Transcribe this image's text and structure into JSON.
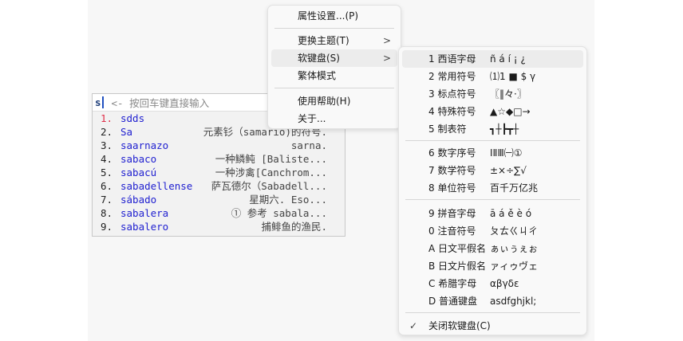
{
  "candidate": {
    "input_code": "s",
    "hint": "<- 按回车键直接输入",
    "items": [
      {
        "num": "1.",
        "word": "sdds",
        "desc": ""
      },
      {
        "num": "2.",
        "word": "Sa",
        "desc": "元素钐（samario)的符号."
      },
      {
        "num": "3.",
        "word": "saarnazo",
        "desc": "sarna."
      },
      {
        "num": "4.",
        "word": "sabaco",
        "desc": "一种鳞鲀 [Baliste..."
      },
      {
        "num": "5.",
        "word": "sabacú",
        "desc": "一种涉禽[Canchrom..."
      },
      {
        "num": "6.",
        "word": "sabadellense",
        "desc": "萨瓦德尔（Sabadell..."
      },
      {
        "num": "7.",
        "word": "sábado",
        "desc": "星期六. Eso..."
      },
      {
        "num": "8.",
        "word": "sabalera",
        "desc": "① 参考 sabala..."
      },
      {
        "num": "9.",
        "word": "sabalero",
        "desc": "捕鲱鱼的渔民."
      }
    ]
  },
  "context_menu": {
    "properties": "属性设置...(P)",
    "change_theme": "更换主题(T)",
    "soft_keyboard": "软键盘(S)",
    "traditional": "繁体模式",
    "help": "使用帮助(H)",
    "about": "关于...",
    "arrow": ">"
  },
  "soft_keyboard_menu": {
    "items": [
      {
        "label": "1 西语字母",
        "sample": "ñ á í ¡ ¿"
      },
      {
        "label": "2 常用符号",
        "sample": "⑴1 ■ $ γ"
      },
      {
        "label": "3 标点符号",
        "sample": "〖‖々·〗"
      },
      {
        "label": "4 特殊符号",
        "sample": "▲☆◆□→"
      },
      {
        "label": "5 制表符",
        "sample": "┓┼┣┳┼"
      },
      {
        "label": "6 数字序号",
        "sample": "ⅠⅡⅢ㈠①"
      },
      {
        "label": "7 数学符号",
        "sample": "±×÷∑√"
      },
      {
        "label": "8 单位符号",
        "sample": "百千万亿兆"
      },
      {
        "label": "9 拼音字母",
        "sample": "ā á ě è ó"
      },
      {
        "label": "0 注音符号",
        "sample": "ㄆㄊㄍㄐㄔ"
      },
      {
        "label": "A 日文平假名",
        "sample": "ぁぃぅぇぉ"
      },
      {
        "label": "B 日文片假名",
        "sample": "ァィゥヴェ"
      },
      {
        "label": "C 希腊字母",
        "sample": "αβγδε"
      },
      {
        "label": "D 普通键盘",
        "sample": "asdfghjkl;"
      }
    ],
    "close": "关闭软键盘(C)",
    "check": "✓"
  }
}
